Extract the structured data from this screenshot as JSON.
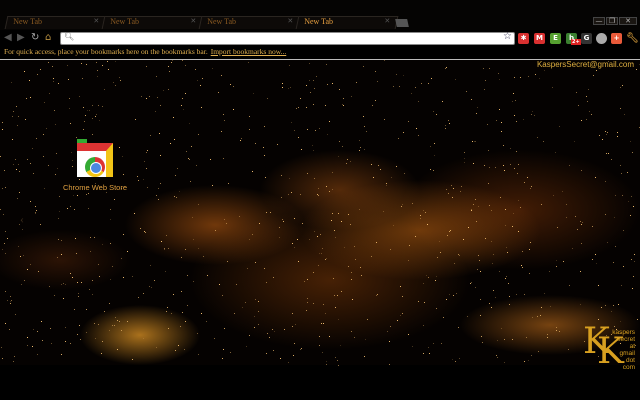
{
  "tabs": [
    {
      "label": "New Tab",
      "active": false
    },
    {
      "label": "New Tab",
      "active": false
    },
    {
      "label": "New Tab",
      "active": false
    },
    {
      "label": "New Tab",
      "active": true
    }
  ],
  "window_controls": {
    "minimize": "—",
    "restore": "❐",
    "close": "✕"
  },
  "omnibox": {
    "value": "",
    "placeholder": ""
  },
  "extensions": [
    {
      "name": "extension-red",
      "color": "#d83030",
      "glyph": "✱"
    },
    {
      "name": "gmail",
      "color": "#d83030",
      "glyph": "M"
    },
    {
      "name": "evernote",
      "color": "#55a030",
      "glyph": "E"
    },
    {
      "name": "extension-green-badge",
      "color": "#3a8030",
      "glyph": "b",
      "badge": "2+"
    },
    {
      "name": "google",
      "color": "#333333",
      "glyph": "G"
    },
    {
      "name": "extension-gray",
      "color": "#aaaaaa",
      "glyph": "●"
    },
    {
      "name": "google-plus",
      "color": "#e85a3a",
      "glyph": "+"
    }
  ],
  "bookmarks_bar": {
    "message": "For quick access, place your bookmarks here on the bookmarks bar.",
    "import_link": "Import bookmarks now..."
  },
  "user": "KaspersSecret@gmail.com",
  "apps": [
    {
      "label": "Chrome Web Store"
    }
  ],
  "theme_signature": {
    "letters": "KK",
    "text": [
      "kaspers",
      "secret",
      "at",
      "gmail",
      "dot",
      "com"
    ]
  }
}
